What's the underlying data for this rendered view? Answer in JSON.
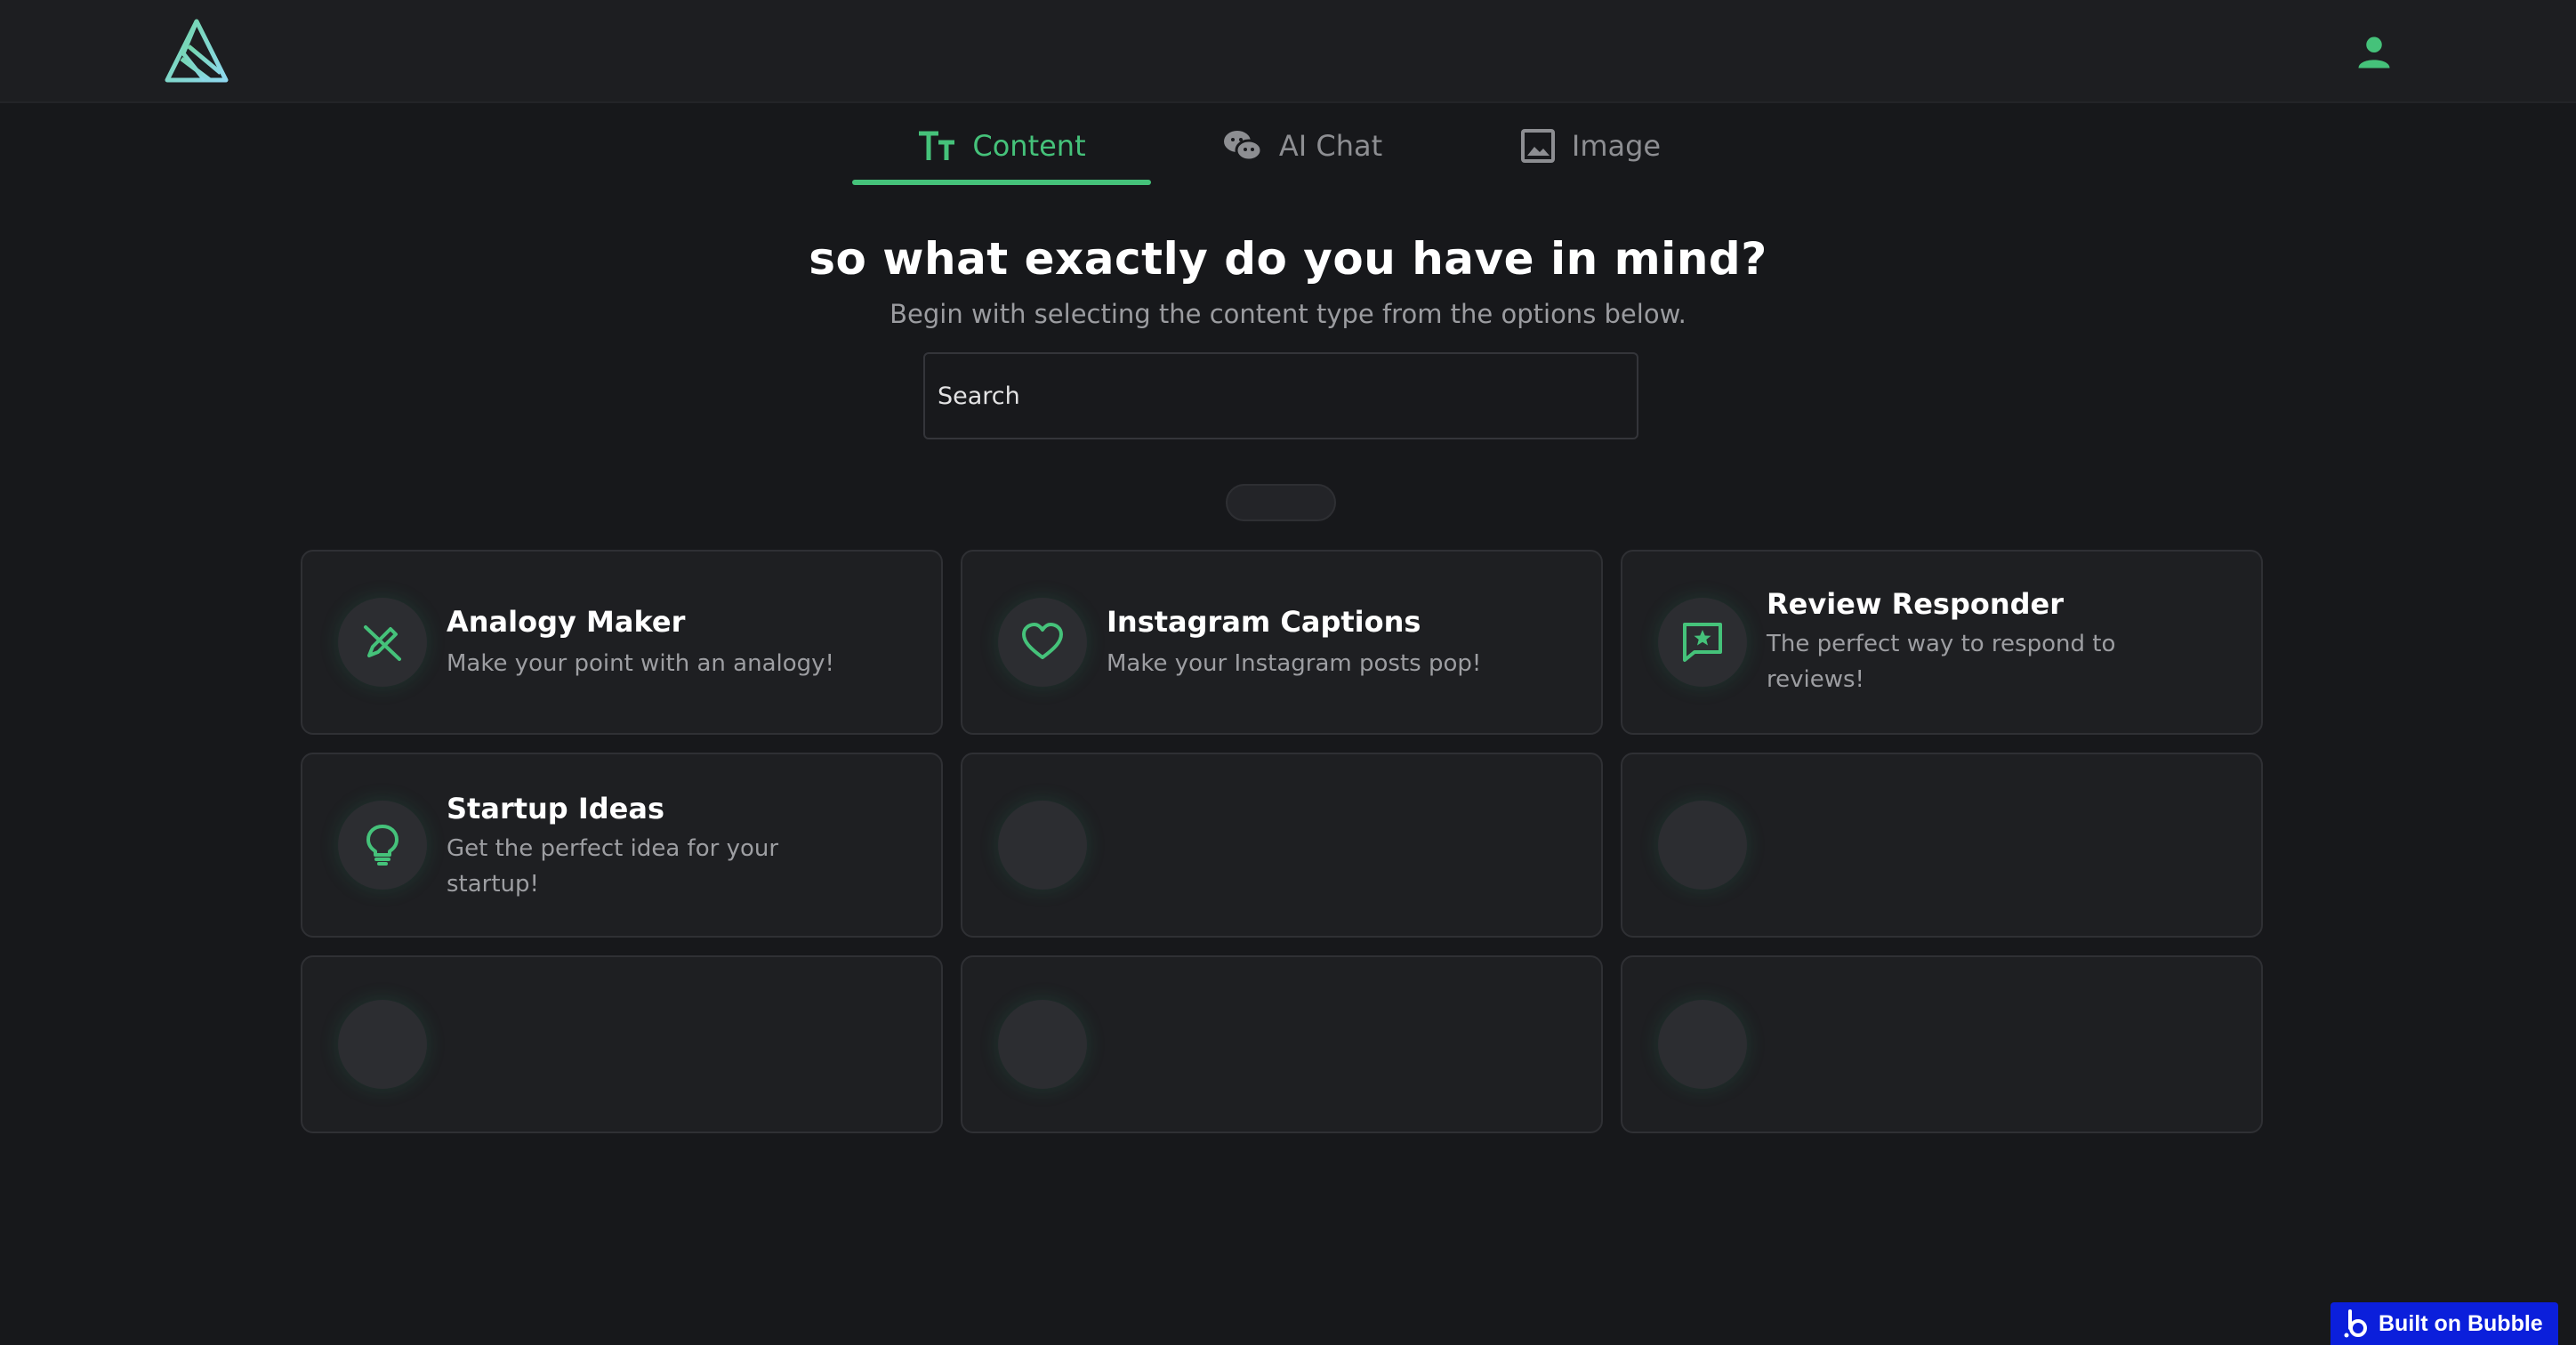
{
  "header": {
    "logo_icon": "brand-logo-icon",
    "user_icon": "user-icon"
  },
  "tabs": [
    {
      "label": "Content",
      "icon": "text-size-icon",
      "active": true
    },
    {
      "label": "AI Chat",
      "icon": "chat-bubbles-icon",
      "active": false
    },
    {
      "label": "Image",
      "icon": "image-icon",
      "active": false
    }
  ],
  "hero": {
    "headline": "so what exactly do you have in mind?",
    "subheadline": "Begin with selecting the content type from the options below."
  },
  "search": {
    "placeholder": "Search"
  },
  "cards": [
    {
      "title": "Analogy Maker",
      "description": "Make your point with an analogy!",
      "icon": "pencil-slash-icon"
    },
    {
      "title": "Instagram Captions",
      "description": "Make your Instagram posts pop!",
      "icon": "heart-icon"
    },
    {
      "title": "Review Responder",
      "description": "The perfect way to respond to reviews!",
      "icon": "star-message-icon"
    },
    {
      "title": "Startup Ideas",
      "description": "Get the perfect idea for your startup!",
      "icon": "lightbulb-icon"
    }
  ],
  "footer": {
    "badge_label": "Built on Bubble",
    "badge_icon": "bubble-logo-icon"
  },
  "colors": {
    "accent": "#45c27a",
    "background": "#17181b",
    "card": "#1e1f22",
    "badge": "#0b1fdb"
  }
}
